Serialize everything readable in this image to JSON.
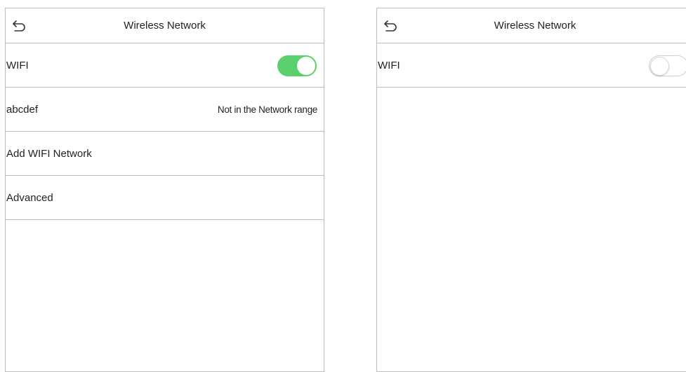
{
  "colors": {
    "accent": "#5bd16e",
    "divider": "#bdbdbd",
    "text": "#222222"
  },
  "screens": [
    {
      "header": {
        "back_icon": "back-arrow-icon",
        "title": "Wireless Network"
      },
      "wifi_row": {
        "label": "WIFI",
        "toggle_state": "on"
      },
      "network_row": {
        "ssid": "abcdef",
        "status": "Not in the Network range"
      },
      "add_network_row": {
        "label": "Add WIFI Network"
      },
      "advanced_row": {
        "label": "Advanced"
      }
    },
    {
      "header": {
        "back_icon": "back-arrow-icon",
        "title": "Wireless Network"
      },
      "wifi_row": {
        "label": "WIFI",
        "toggle_state": "off"
      }
    }
  ]
}
